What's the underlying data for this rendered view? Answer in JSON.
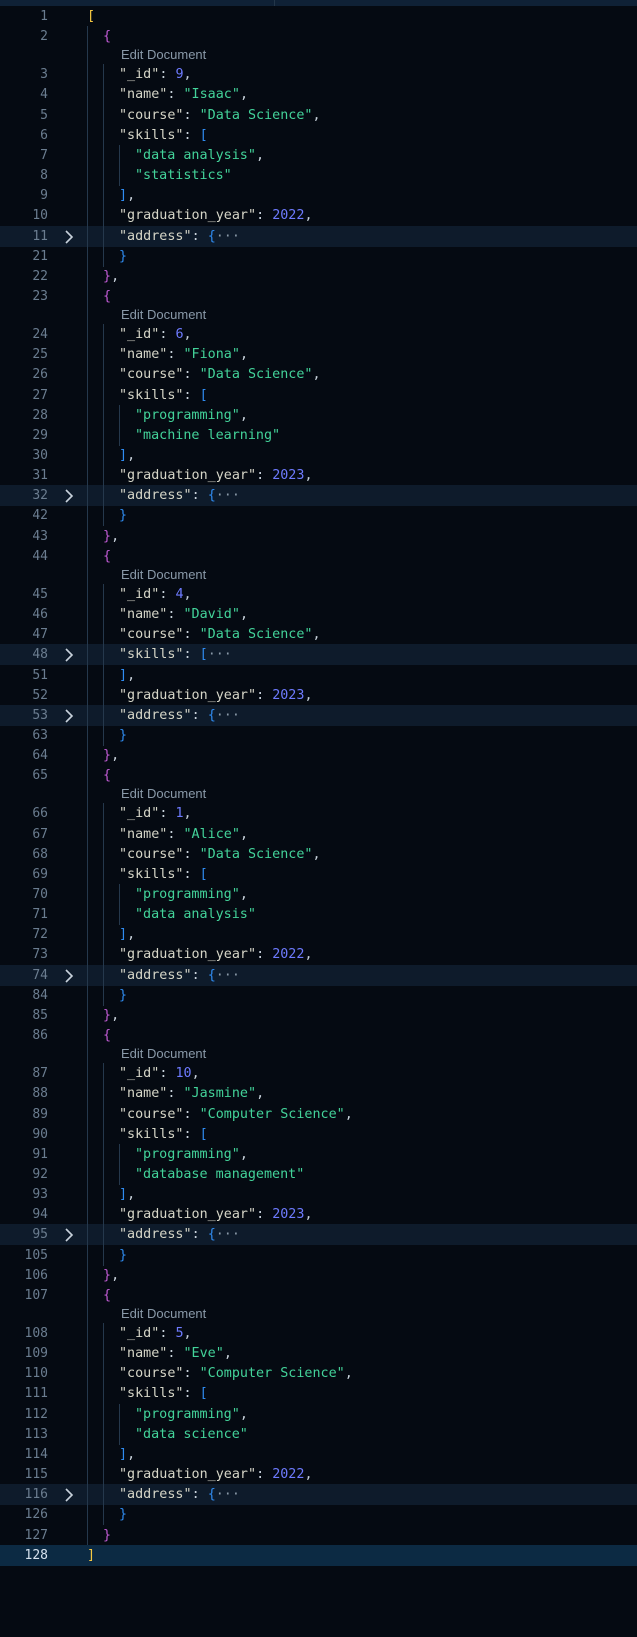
{
  "editor": {
    "lens_label": "Edit Document",
    "ellipsis": "···",
    "keys": {
      "id": "\"_id\"",
      "name": "\"name\"",
      "course": "\"course\"",
      "skills": "\"skills\"",
      "graduation_year": "\"graduation_year\"",
      "address": "\"address\""
    },
    "current_line": 128,
    "documents": [
      {
        "id": 9,
        "name": "Isaac",
        "course": "Data Science",
        "skills": [
          "data analysis",
          "statistics"
        ],
        "skills_folded": false,
        "graduation_year": 2022,
        "ln": {
          "open": 2,
          "id": 3,
          "name": 4,
          "course": 5,
          "skills": 6,
          "skills_close": 9,
          "grad": 10,
          "address": 11,
          "address_close": 21,
          "close": 22
        },
        "skill_lns": [
          7,
          8
        ]
      },
      {
        "id": 6,
        "name": "Fiona",
        "course": "Data Science",
        "skills": [
          "programming",
          "machine learning"
        ],
        "skills_folded": false,
        "graduation_year": 2023,
        "ln": {
          "open": 23,
          "id": 24,
          "name": 25,
          "course": 26,
          "skills": 27,
          "skills_close": 30,
          "grad": 31,
          "address": 32,
          "address_close": 42,
          "close": 43
        },
        "skill_lns": [
          28,
          29
        ]
      },
      {
        "id": 4,
        "name": "David",
        "course": "Data Science",
        "skills": [],
        "skills_folded": true,
        "graduation_year": 2023,
        "ln": {
          "open": 44,
          "id": 45,
          "name": 46,
          "course": 47,
          "skills": 48,
          "skills_close": 51,
          "grad": 52,
          "address": 53,
          "address_close": 63,
          "close": 64
        },
        "skill_lns": []
      },
      {
        "id": 1,
        "name": "Alice",
        "course": "Data Science",
        "skills": [
          "programming",
          "data analysis"
        ],
        "skills_folded": false,
        "graduation_year": 2022,
        "ln": {
          "open": 65,
          "id": 66,
          "name": 67,
          "course": 68,
          "skills": 69,
          "skills_close": 72,
          "grad": 73,
          "address": 74,
          "address_close": 84,
          "close": 85
        },
        "skill_lns": [
          70,
          71
        ]
      },
      {
        "id": 10,
        "name": "Jasmine",
        "course": "Computer Science",
        "skills": [
          "programming",
          "database management"
        ],
        "skills_folded": false,
        "graduation_year": 2023,
        "ln": {
          "open": 86,
          "id": 87,
          "name": 88,
          "course": 89,
          "skills": 90,
          "skills_close": 93,
          "grad": 94,
          "address": 95,
          "address_close": 105,
          "close": 106
        },
        "skill_lns": [
          91,
          92
        ]
      },
      {
        "id": 5,
        "name": "Eve",
        "course": "Computer Science",
        "skills": [
          "programming",
          "data science"
        ],
        "skills_folded": false,
        "graduation_year": 2022,
        "ln": {
          "open": 107,
          "id": 108,
          "name": 109,
          "course": 110,
          "skills": 111,
          "skills_close": 114,
          "grad": 115,
          "address": 116,
          "address_close": 126,
          "close": 127
        },
        "skill_lns": [
          112,
          113
        ]
      }
    ],
    "first_line": 1,
    "last_line": 128
  }
}
